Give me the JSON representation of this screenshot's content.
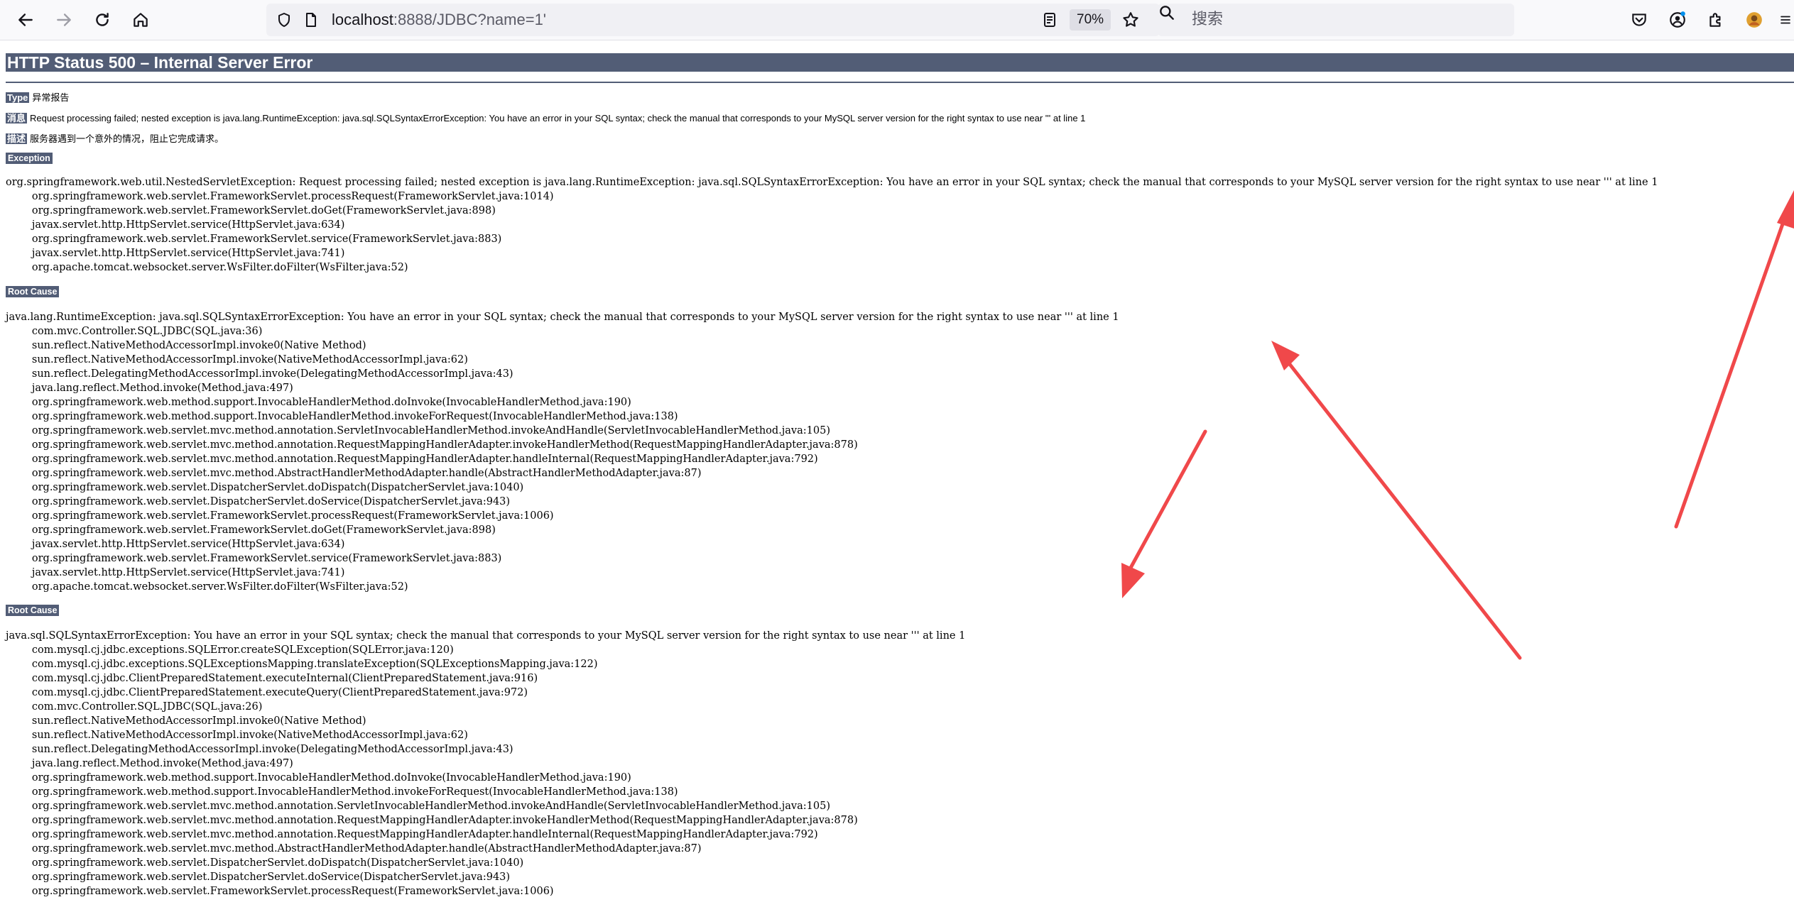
{
  "browser": {
    "url_host": "localhost",
    "url_rest": ":8888/JDBC?name=1'",
    "zoom": "70%",
    "search_placeholder": "搜索"
  },
  "page": {
    "title": "HTTP Status 500 – Internal Server Error",
    "type_label": "Type",
    "type_value": "异常报告",
    "message_label": "消息",
    "message_value": "Request processing failed; nested exception is java.lang.RuntimeException: java.sql.SQLSyntaxErrorException: You have an error in your SQL syntax; check the manual that corresponds to your MySQL server version for the right syntax to use near ''' at line 1",
    "description_label": "描述",
    "description_value": "服务器遇到一个意外的情况，阻止它完成请求。",
    "exception_heading": "Exception",
    "exception_trace": "org.springframework.web.util.NestedServletException: Request processing failed; nested exception is java.lang.RuntimeException: java.sql.SQLSyntaxErrorException: You have an error in your SQL syntax; check the manual that corresponds to your MySQL server version for the right syntax to use near ''' at line 1\n\torg.springframework.web.servlet.FrameworkServlet.processRequest(FrameworkServlet.java:1014)\n\torg.springframework.web.servlet.FrameworkServlet.doGet(FrameworkServlet.java:898)\n\tjavax.servlet.http.HttpServlet.service(HttpServlet.java:634)\n\torg.springframework.web.servlet.FrameworkServlet.service(FrameworkServlet.java:883)\n\tjavax.servlet.http.HttpServlet.service(HttpServlet.java:741)\n\torg.apache.tomcat.websocket.server.WsFilter.doFilter(WsFilter.java:52)",
    "root_cause_heading_1": "Root Cause",
    "root_cause_trace_1": "java.lang.RuntimeException: java.sql.SQLSyntaxErrorException: You have an error in your SQL syntax; check the manual that corresponds to your MySQL server version for the right syntax to use near ''' at line 1\n\tcom.mvc.Controller.SQL.JDBC(SQL.java:36)\n\tsun.reflect.NativeMethodAccessorImpl.invoke0(Native Method)\n\tsun.reflect.NativeMethodAccessorImpl.invoke(NativeMethodAccessorImpl.java:62)\n\tsun.reflect.DelegatingMethodAccessorImpl.invoke(DelegatingMethodAccessorImpl.java:43)\n\tjava.lang.reflect.Method.invoke(Method.java:497)\n\torg.springframework.web.method.support.InvocableHandlerMethod.doInvoke(InvocableHandlerMethod.java:190)\n\torg.springframework.web.method.support.InvocableHandlerMethod.invokeForRequest(InvocableHandlerMethod.java:138)\n\torg.springframework.web.servlet.mvc.method.annotation.ServletInvocableHandlerMethod.invokeAndHandle(ServletInvocableHandlerMethod.java:105)\n\torg.springframework.web.servlet.mvc.method.annotation.RequestMappingHandlerAdapter.invokeHandlerMethod(RequestMappingHandlerAdapter.java:878)\n\torg.springframework.web.servlet.mvc.method.annotation.RequestMappingHandlerAdapter.handleInternal(RequestMappingHandlerAdapter.java:792)\n\torg.springframework.web.servlet.mvc.method.AbstractHandlerMethodAdapter.handle(AbstractHandlerMethodAdapter.java:87)\n\torg.springframework.web.servlet.DispatcherServlet.doDispatch(DispatcherServlet.java:1040)\n\torg.springframework.web.servlet.DispatcherServlet.doService(DispatcherServlet.java:943)\n\torg.springframework.web.servlet.FrameworkServlet.processRequest(FrameworkServlet.java:1006)\n\torg.springframework.web.servlet.FrameworkServlet.doGet(FrameworkServlet.java:898)\n\tjavax.servlet.http.HttpServlet.service(HttpServlet.java:634)\n\torg.springframework.web.servlet.FrameworkServlet.service(FrameworkServlet.java:883)\n\tjavax.servlet.http.HttpServlet.service(HttpServlet.java:741)\n\torg.apache.tomcat.websocket.server.WsFilter.doFilter(WsFilter.java:52)",
    "root_cause_heading_2": "Root Cause",
    "root_cause_trace_2": "java.sql.SQLSyntaxErrorException: You have an error in your SQL syntax; check the manual that corresponds to your MySQL server version for the right syntax to use near ''' at line 1\n\tcom.mysql.cj.jdbc.exceptions.SQLError.createSQLException(SQLError.java:120)\n\tcom.mysql.cj.jdbc.exceptions.SQLExceptionsMapping.translateException(SQLExceptionsMapping.java:122)\n\tcom.mysql.cj.jdbc.ClientPreparedStatement.executeInternal(ClientPreparedStatement.java:916)\n\tcom.mysql.cj.jdbc.ClientPreparedStatement.executeQuery(ClientPreparedStatement.java:972)\n\tcom.mvc.Controller.SQL.JDBC(SQL.java:26)\n\tsun.reflect.NativeMethodAccessorImpl.invoke0(Native Method)\n\tsun.reflect.NativeMethodAccessorImpl.invoke(NativeMethodAccessorImpl.java:62)\n\tsun.reflect.DelegatingMethodAccessorImpl.invoke(DelegatingMethodAccessorImpl.java:43)\n\tjava.lang.reflect.Method.invoke(Method.java:497)\n\torg.springframework.web.method.support.InvocableHandlerMethod.doInvoke(InvocableHandlerMethod.java:190)\n\torg.springframework.web.method.support.InvocableHandlerMethod.invokeForRequest(InvocableHandlerMethod.java:138)\n\torg.springframework.web.servlet.mvc.method.annotation.ServletInvocableHandlerMethod.invokeAndHandle(ServletInvocableHandlerMethod.java:105)\n\torg.springframework.web.servlet.mvc.method.annotation.RequestMappingHandlerAdapter.invokeHandlerMethod(RequestMappingHandlerAdapter.java:878)\n\torg.springframework.web.servlet.mvc.method.annotation.RequestMappingHandlerAdapter.handleInternal(RequestMappingHandlerAdapter.java:792)\n\torg.springframework.web.servlet.mvc.method.AbstractHandlerMethodAdapter.handle(AbstractHandlerMethodAdapter.java:87)\n\torg.springframework.web.servlet.DispatcherServlet.doDispatch(DispatcherServlet.java:1040)\n\torg.springframework.web.servlet.DispatcherServlet.doService(DispatcherServlet.java:943)\n\torg.springframework.web.servlet.FrameworkServlet.processRequest(FrameworkServlet.java:1006)"
  },
  "annotation_color": "#f0484a"
}
